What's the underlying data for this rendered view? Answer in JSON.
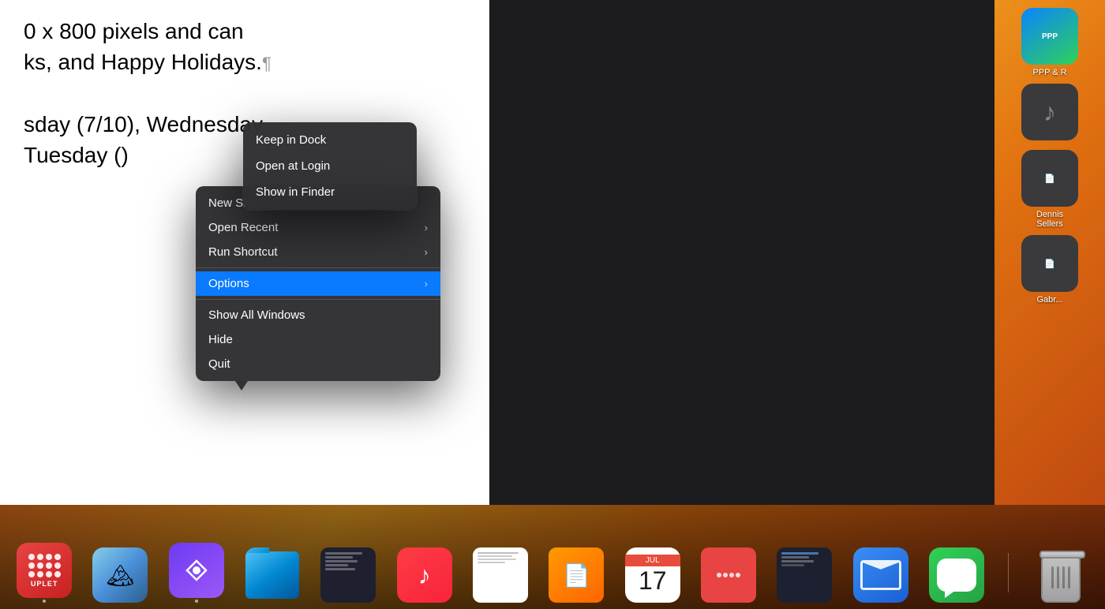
{
  "desktop": {
    "background": "orange-gradient"
  },
  "document": {
    "line1": "0 x 800 pixels and can",
    "line2": "ks, and Happy Holidays.",
    "paragraph_mark": "¶",
    "line3": "sday (7/10), Wednesday",
    "line4": "Tuesday ()"
  },
  "context_menu": {
    "items": [
      {
        "id": "new-shortcut",
        "label": "New Shortcut",
        "has_arrow": false,
        "highlighted": false
      },
      {
        "id": "open-recent",
        "label": "Open Recent",
        "has_arrow": true,
        "highlighted": false
      },
      {
        "id": "run-shortcut",
        "label": "Run Shortcut",
        "has_arrow": true,
        "highlighted": false
      },
      {
        "separator": true
      },
      {
        "id": "options",
        "label": "Options",
        "has_arrow": true,
        "highlighted": true
      },
      {
        "separator": true
      },
      {
        "id": "show-all-windows",
        "label": "Show All Windows",
        "has_arrow": false,
        "highlighted": false
      },
      {
        "id": "hide",
        "label": "Hide",
        "has_arrow": false,
        "highlighted": false
      },
      {
        "id": "quit",
        "label": "Quit",
        "has_arrow": false,
        "highlighted": false
      }
    ]
  },
  "submenu": {
    "items": [
      {
        "id": "keep-in-dock",
        "label": "Keep in Dock"
      },
      {
        "id": "open-at-login",
        "label": "Open at Login"
      },
      {
        "id": "show-in-finder",
        "label": "Show in Finder"
      }
    ]
  },
  "dock": {
    "items": [
      {
        "id": "uplet",
        "label": "UPLET",
        "type": "uplet"
      },
      {
        "id": "preview",
        "label": "Preview",
        "type": "preview"
      },
      {
        "id": "shortcuts",
        "label": "Shortcuts",
        "type": "shortcuts"
      },
      {
        "id": "folder",
        "label": "Folder",
        "type": "folder"
      },
      {
        "id": "thumb1",
        "label": "",
        "type": "thumb-dark"
      },
      {
        "id": "music",
        "label": "Music",
        "type": "music"
      },
      {
        "id": "thumb2",
        "label": "",
        "type": "thumb-doc"
      },
      {
        "id": "thumb3",
        "label": "",
        "type": "thumb-pages"
      },
      {
        "id": "calendar",
        "label": "Calendar",
        "type": "calendar",
        "date": "17",
        "month": "JUL"
      },
      {
        "id": "thumb4",
        "label": "",
        "type": "thumb-uplet"
      },
      {
        "id": "thumb5",
        "label": "",
        "type": "thumb-dark2"
      },
      {
        "id": "mail",
        "label": "Mail",
        "type": "mail"
      },
      {
        "id": "messages",
        "label": "Messages",
        "type": "messages"
      },
      {
        "id": "trash",
        "label": "Trash",
        "type": "trash"
      }
    ]
  },
  "desktop_icons": [
    {
      "id": "ppp",
      "label": "PPP & R",
      "type": "ppp"
    },
    {
      "id": "music-file",
      "label": "",
      "type": "music-file"
    },
    {
      "id": "dennis",
      "label": "Dennis\nSellers",
      "type": "dennis"
    },
    {
      "id": "gabriel",
      "label": "Gabr...",
      "type": "gabriel"
    }
  ]
}
